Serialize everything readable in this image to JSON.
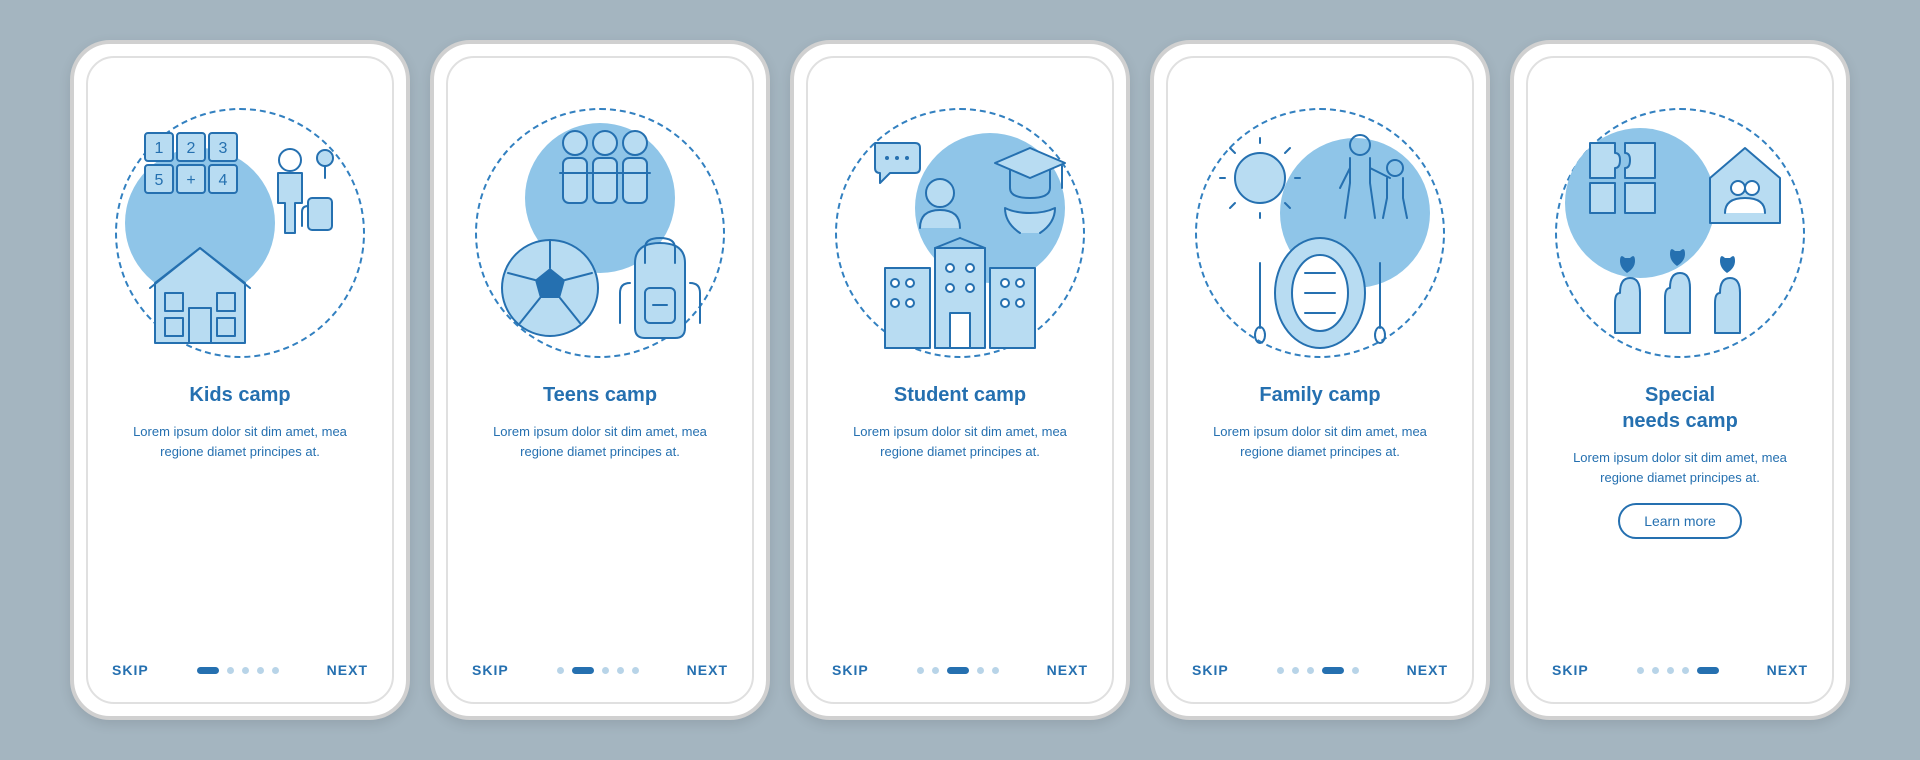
{
  "common": {
    "skip": "SKIP",
    "next": "NEXT",
    "description": "Lorem ipsum dolor sit dim amet, mea regione diamet principes at.",
    "learn_more": "Learn more"
  },
  "screens": [
    {
      "title": "Kids camp",
      "active_dot": 0
    },
    {
      "title": "Teens camp",
      "active_dot": 1
    },
    {
      "title": "Student camp",
      "active_dot": 2
    },
    {
      "title": "Family camp",
      "active_dot": 3
    },
    {
      "title": "Special\nneeds camp",
      "active_dot": 4,
      "has_button": true
    }
  ]
}
